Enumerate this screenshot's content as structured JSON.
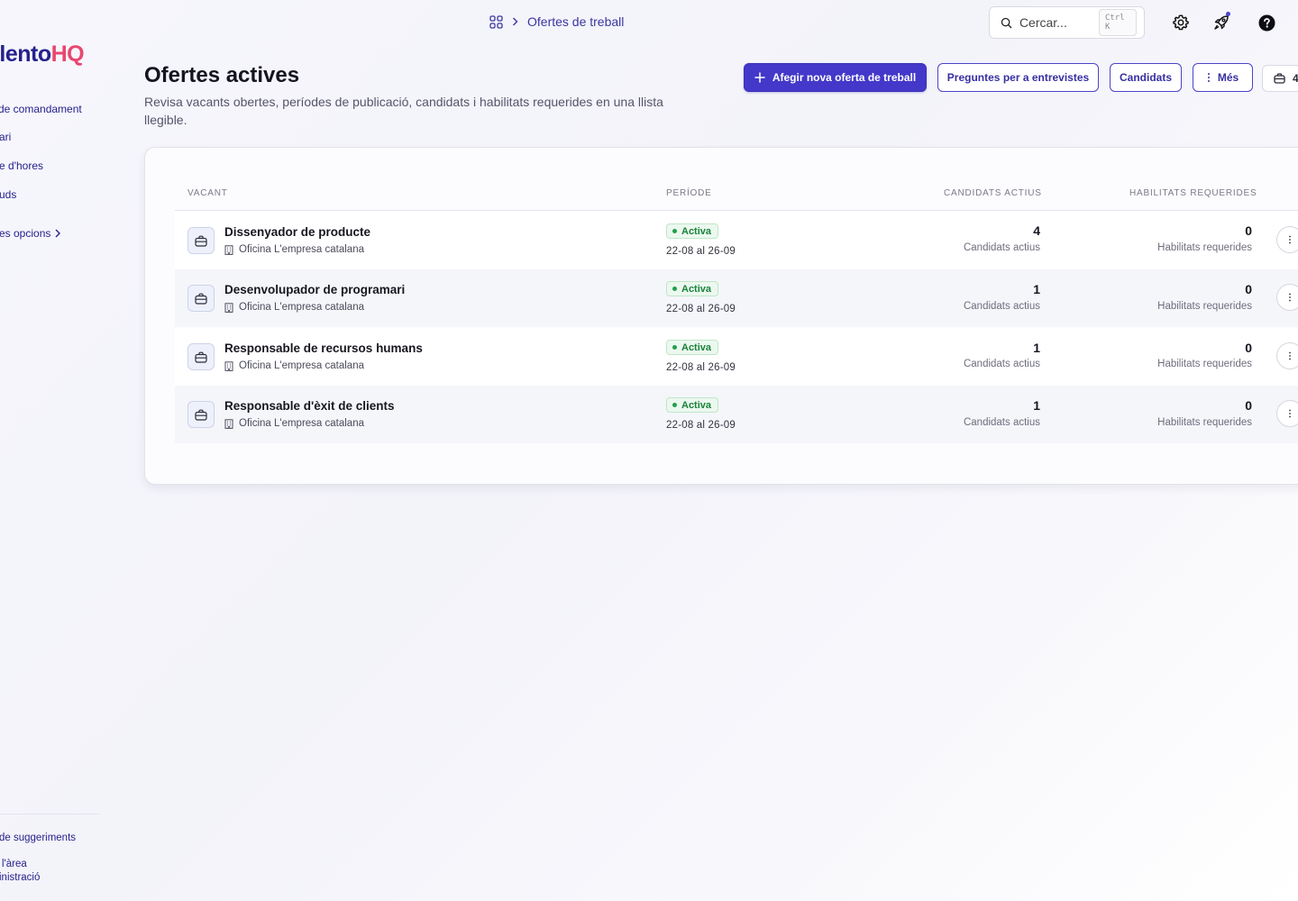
{
  "sidebar": {
    "logo_main": "alento",
    "logo_accent": "HQ",
    "items": [
      {
        "label": " de comandament"
      },
      {
        "label": "ari"
      },
      {
        "label": "e d'hores"
      },
      {
        "label": "uds"
      }
    ],
    "more_label": "es opcions",
    "footer": {
      "suggestions": "de suggeriments",
      "admin_line1": "l'àrea",
      "admin_line2": "inistració"
    }
  },
  "topbar": {
    "breadcrumb_current": "Ofertes de treball",
    "search_placeholder": "Cercar...",
    "search_shortcut": "Ctrl K",
    "icons": [
      "settings-icon",
      "rocket-icon",
      "help-icon"
    ]
  },
  "header": {
    "title": "Ofertes actives",
    "description": "Revisa vacants obertes, períodes de publicació, candidats i habilitats requerides en una llista llegible.",
    "actions": {
      "add_job": "Afegir nova oferta de treball",
      "interview_questions": "Preguntes per a entrevistes",
      "candidates": "Candidats",
      "more": "Més",
      "count": "4"
    }
  },
  "table": {
    "columns": {
      "vacancy": "VACANT",
      "period": "PERÍODE",
      "active_candidates": "CANDIDATS ACTIUS",
      "required_skills": "HABILITATS REQUERIDES"
    },
    "rows": [
      {
        "title": "Dissenyador de producte",
        "location": "Oficina L'empresa catalana",
        "status": "Activa",
        "period": "22-08 al 26-09",
        "candidates": "4",
        "candidates_label": "Candidats actius",
        "skills": "0",
        "skills_label": "Habilitats requerides"
      },
      {
        "title": "Desenvolupador de programari",
        "location": "Oficina L'empresa catalana",
        "status": "Activa",
        "period": "22-08 al 26-09",
        "candidates": "1",
        "candidates_label": "Candidats actius",
        "skills": "0",
        "skills_label": "Habilitats requerides"
      },
      {
        "title": "Responsable de recursos humans",
        "location": "Oficina L'empresa catalana",
        "status": "Activa",
        "period": "22-08 al 26-09",
        "candidates": "1",
        "candidates_label": "Candidats actius",
        "skills": "0",
        "skills_label": "Habilitats requerides"
      },
      {
        "title": "Responsable d'èxit de clients",
        "location": "Oficina L'empresa catalana",
        "status": "Activa",
        "period": "22-08 al 26-09",
        "candidates": "1",
        "candidates_label": "Candidats actius",
        "skills": "0",
        "skills_label": "Habilitats requerides"
      }
    ]
  },
  "colors": {
    "brand": "#26218c",
    "brand_accent": "#e8476f",
    "primary_button": "#4338ca",
    "status_active": "#18833a"
  }
}
